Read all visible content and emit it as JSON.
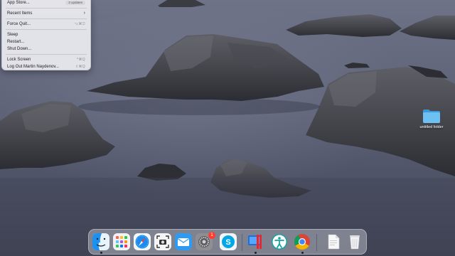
{
  "apple_menu": {
    "items": [
      {
        "label": "App Store...",
        "badge": "3 updates"
      },
      {
        "label": "Recent Items",
        "submenu": "›"
      },
      {
        "label": "Force Quit...",
        "shortcut": "⌥⌘⎋"
      },
      {
        "label": "Sleep"
      },
      {
        "label": "Restart..."
      },
      {
        "label": "Shut Down..."
      },
      {
        "label": "Lock Screen",
        "shortcut": "^⌘Q"
      },
      {
        "label": "Log Out Martin Naydenov...",
        "shortcut": "⇧⌘Q"
      }
    ]
  },
  "desktop": {
    "folder": {
      "label": "untitled folder",
      "icon": "folder-icon"
    }
  },
  "dock": {
    "items": [
      {
        "name": "finder",
        "icon": "finder-icon",
        "running": true
      },
      {
        "name": "launchpad",
        "icon": "launchpad-icon"
      },
      {
        "name": "safari",
        "icon": "safari-icon"
      },
      {
        "name": "screenshot",
        "icon": "screenshot-icon"
      },
      {
        "name": "mail",
        "icon": "mail-icon"
      },
      {
        "name": "system-preferences",
        "icon": "gear-icon",
        "badge": "1"
      },
      {
        "name": "skype",
        "icon": "skype-icon"
      },
      {
        "name": "parallels",
        "icon": "parallels-icon"
      },
      {
        "name": "xcode-accessibility",
        "icon": "accessibility-icon"
      },
      {
        "name": "chrome",
        "icon": "chrome-icon"
      },
      {
        "name": "document",
        "icon": "document-icon"
      },
      {
        "name": "trash",
        "icon": "trash-icon"
      }
    ]
  },
  "colors": {
    "menu_bg": "#ececf0",
    "folder_blue": "#5ab3ec",
    "badge_red": "#ff3b30",
    "sky": "#6b6f82",
    "sea": "#52576a"
  }
}
